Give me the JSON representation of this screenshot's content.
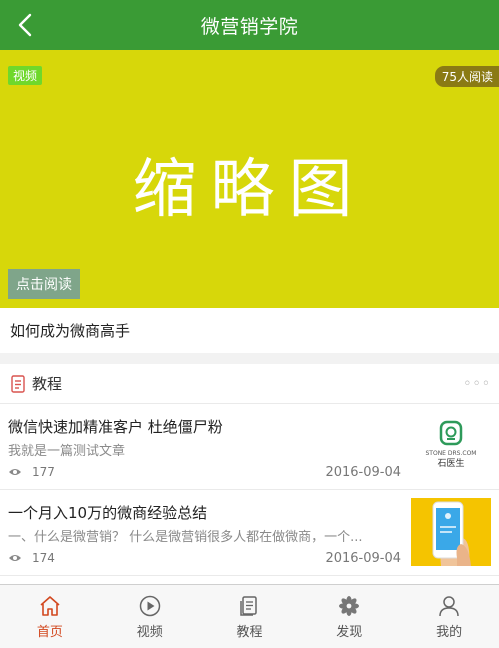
{
  "header": {
    "title": "微营销学院",
    "back_icon": "chevron-left-icon"
  },
  "hero": {
    "tag": "视频",
    "readers": "75人阅读",
    "thumbnail_text": "缩略图",
    "read_button": "点击阅读",
    "caption": "如何成为微商高手",
    "bg_color": "#d7d70a"
  },
  "section": {
    "title": "教程",
    "more": "◦◦◦",
    "articles": [
      {
        "title": "微信快速加精准客户 杜绝僵尸粉",
        "desc": "我就是一篇测试文章",
        "views": "177",
        "date": "2016-09-04",
        "thumb_brand": "石医生",
        "thumb_url": "STONE DRS.COM"
      },
      {
        "title": "一个月入10万的微商经验总结",
        "desc": "一、什么是微营销？ 什么是微营销很多人都在做微商，一个...",
        "views": "174",
        "date": "2016-09-04"
      }
    ]
  },
  "tabbar": {
    "items": [
      {
        "label": "首页",
        "icon": "home-icon",
        "active": true
      },
      {
        "label": "视频",
        "icon": "play-icon",
        "active": false
      },
      {
        "label": "教程",
        "icon": "document-icon",
        "active": false
      },
      {
        "label": "发现",
        "icon": "flower-icon",
        "active": false
      },
      {
        "label": "我的",
        "icon": "user-icon",
        "active": false
      }
    ]
  },
  "colors": {
    "header": "#3a9b35",
    "active_tab": "#d2481f"
  }
}
